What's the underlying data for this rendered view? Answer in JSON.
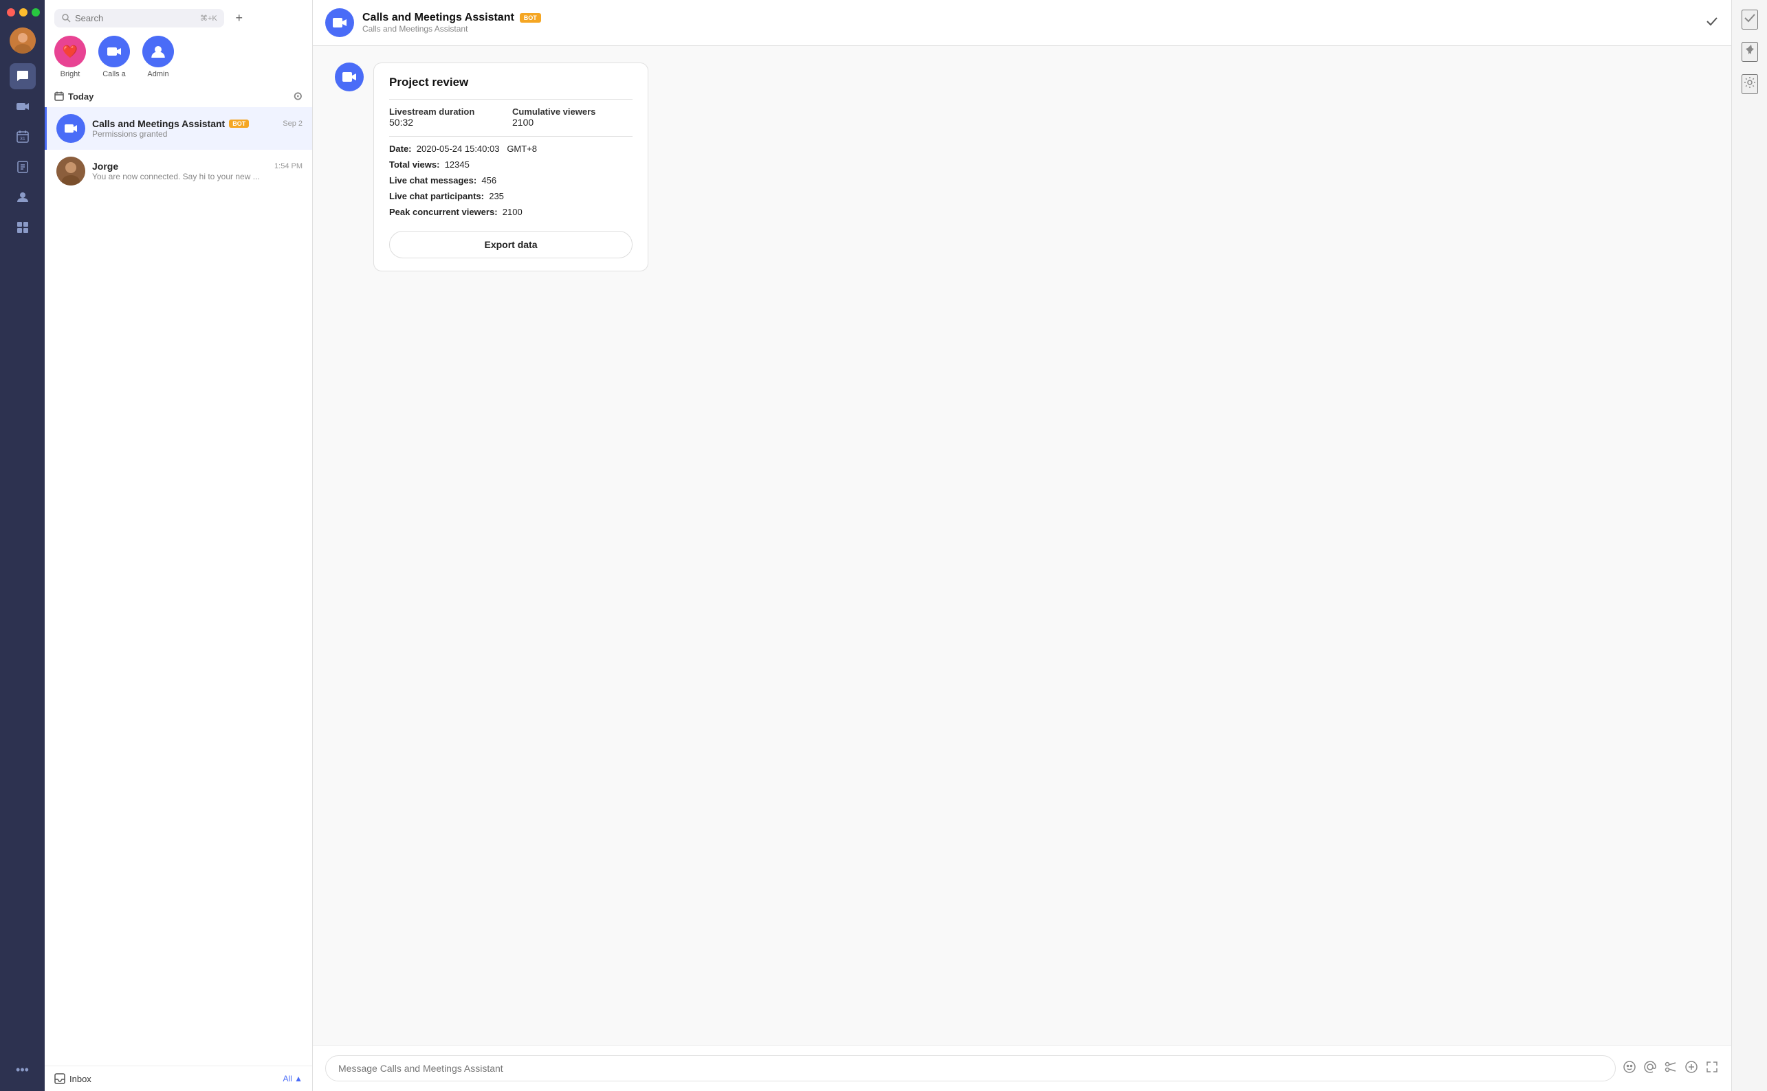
{
  "app": {
    "title": "Calls and Meetings Assistant"
  },
  "traffic_lights": {
    "red": "#ff5f57",
    "yellow": "#febc2e",
    "green": "#28c840"
  },
  "icon_sidebar": {
    "nav_items": [
      {
        "id": "chat",
        "icon": "💬",
        "active": true
      },
      {
        "id": "video",
        "icon": "📹",
        "active": false
      },
      {
        "id": "calendar",
        "icon": "31",
        "active": false
      },
      {
        "id": "tasks",
        "icon": "📋",
        "active": false
      },
      {
        "id": "contacts",
        "icon": "👤",
        "active": false
      },
      {
        "id": "grid",
        "icon": "⊞",
        "active": false
      }
    ],
    "more": "..."
  },
  "search": {
    "placeholder": "Search",
    "shortcut": "⌘+K"
  },
  "recent_contacts": [
    {
      "id": "bright",
      "name": "Bright",
      "color": "#e84393",
      "icon": "❤"
    },
    {
      "id": "calls",
      "name": "Calls a",
      "color": "#4a6cf7",
      "icon": "📹"
    },
    {
      "id": "admin",
      "name": "Admin",
      "color": "#4a6cf7",
      "icon": "👤"
    }
  ],
  "section": {
    "today_label": "Today"
  },
  "conversations": [
    {
      "id": "calls-assistant",
      "name": "Calls and Meetings Assistant",
      "badge": "BOT",
      "time": "Sep 2",
      "preview": "Permissions granted",
      "avatar_icon": "📹",
      "avatar_color": "#4a6cf7",
      "active": true
    },
    {
      "id": "jorge",
      "name": "Jorge",
      "badge": "",
      "time": "1:54 PM",
      "preview": "You are now connected. Say hi to your new ...",
      "avatar_color": "#8b5e3c",
      "avatar_icon": null,
      "active": false
    }
  ],
  "inbox": {
    "label": "Inbox",
    "all_label": "All ▲"
  },
  "chat_header": {
    "name": "Calls and Meetings Assistant",
    "badge": "BOT",
    "subtitle": "Calls and Meetings Assistant",
    "avatar_icon": "📹",
    "avatar_color": "#4a6cf7"
  },
  "message_card": {
    "title": "Project review",
    "stats": [
      {
        "label": "Livestream duration",
        "value": "50:32"
      },
      {
        "label": "Cumulative viewers",
        "value": "2100"
      }
    ],
    "date_label": "Date:",
    "date_value": "2020-05-24 15:40:03",
    "timezone": "GMT+8",
    "total_views_label": "Total views:",
    "total_views": "12345",
    "live_chat_messages_label": "Live chat messages:",
    "live_chat_messages": "456",
    "live_chat_participants_label": "Live chat participants:",
    "live_chat_participants": "235",
    "peak_concurrent_label": "Peak concurrent viewers:",
    "peak_concurrent": "2100",
    "export_btn_label": "Export data"
  },
  "chat_input": {
    "placeholder": "Message Calls and Meetings Assistant"
  },
  "right_sidebar": {
    "icons": [
      "✓",
      "📌",
      "⚙"
    ]
  }
}
